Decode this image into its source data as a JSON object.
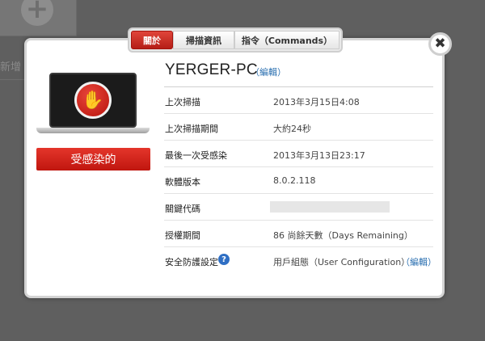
{
  "background": {
    "partial_text": "新增"
  },
  "tabs": [
    {
      "label": "關於",
      "active": true
    },
    {
      "label": "掃描資訊",
      "active": false
    },
    {
      "label": "指令（Commands）",
      "active": false
    }
  ],
  "close_label": "✖",
  "status": {
    "label": "受感染的",
    "color": "#d32219"
  },
  "computer": {
    "name": "YERGER-PC",
    "edit_link": "（編輯）"
  },
  "details": [
    {
      "label": "上次掃描",
      "value": "2013年3月15日4:08"
    },
    {
      "label": "上次掃描期間",
      "value": "大約24秒"
    },
    {
      "label": "最後一次受感染",
      "value": "2013年3月13日23:17"
    },
    {
      "label": "軟體版本",
      "value": "8.0.2.118"
    },
    {
      "label": "關鍵代碼",
      "value": ""
    },
    {
      "label": "授權期間",
      "value": "86 尚餘天數（Days Remaining）"
    },
    {
      "label": "安全防護設定",
      "value": "用戶組態（User Configuration）",
      "help_icon": "?",
      "edit_link": "（編輯）"
    }
  ],
  "colors": {
    "accent_red": "#c8231a",
    "link_blue": "#2a6fb0",
    "help_blue": "#2f6fc4"
  }
}
